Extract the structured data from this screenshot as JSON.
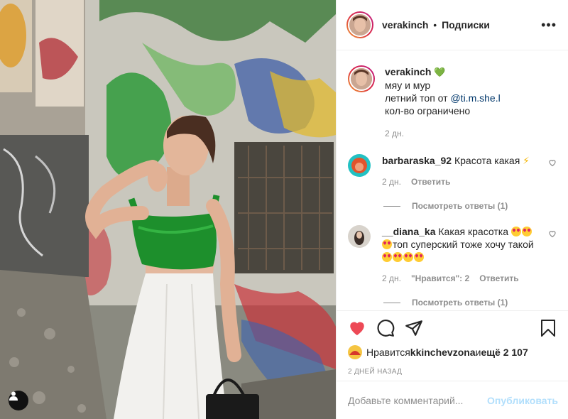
{
  "post": {
    "username": "verakinch",
    "separator": "•",
    "follow_label": "Подписки",
    "more_label": "•••"
  },
  "caption": {
    "username": "verakinch",
    "verified_emoji": "💚",
    "line1": "мяу и мур",
    "line2_prefix": "летний топ от ",
    "mention": "@ti.m.she.l",
    "line3": "кол-во ограничено",
    "time": "2 дн."
  },
  "comments": [
    {
      "username": "barbaraska_92",
      "text": "Красота какая",
      "emoji": "⚡",
      "time": "2 дн.",
      "reply_label": "Ответить",
      "view_replies": "Посмотреть ответы (1)"
    },
    {
      "username": "__diana_ka",
      "text_a": "Какая красотка",
      "text_b": "топ суперский тоже хочу такой",
      "time": "2 дн.",
      "likes_label": "\"Нравится\": 2",
      "reply_label": "Ответить",
      "view_replies": "Посмотреть ответы (1)"
    }
  ],
  "likes": {
    "prefix": "Нравится ",
    "user": "kkinchevzona",
    "middle": " и ",
    "others": "ещё 2 107"
  },
  "post_time": "2 ДНЕЙ НАЗАД",
  "add_comment": {
    "placeholder": "Добавьте комментарий...",
    "publish_label": "Опубликовать"
  },
  "colors": {
    "like_red": "#ed4956",
    "publish_disabled": "#b2dffc",
    "mention": "#00376b",
    "muted": "#8e8e8e"
  },
  "icons": [
    "user-tag-icon",
    "more-icon",
    "like-heart-icon",
    "comment-icon",
    "share-icon",
    "bookmark-icon",
    "small-heart-icon"
  ]
}
